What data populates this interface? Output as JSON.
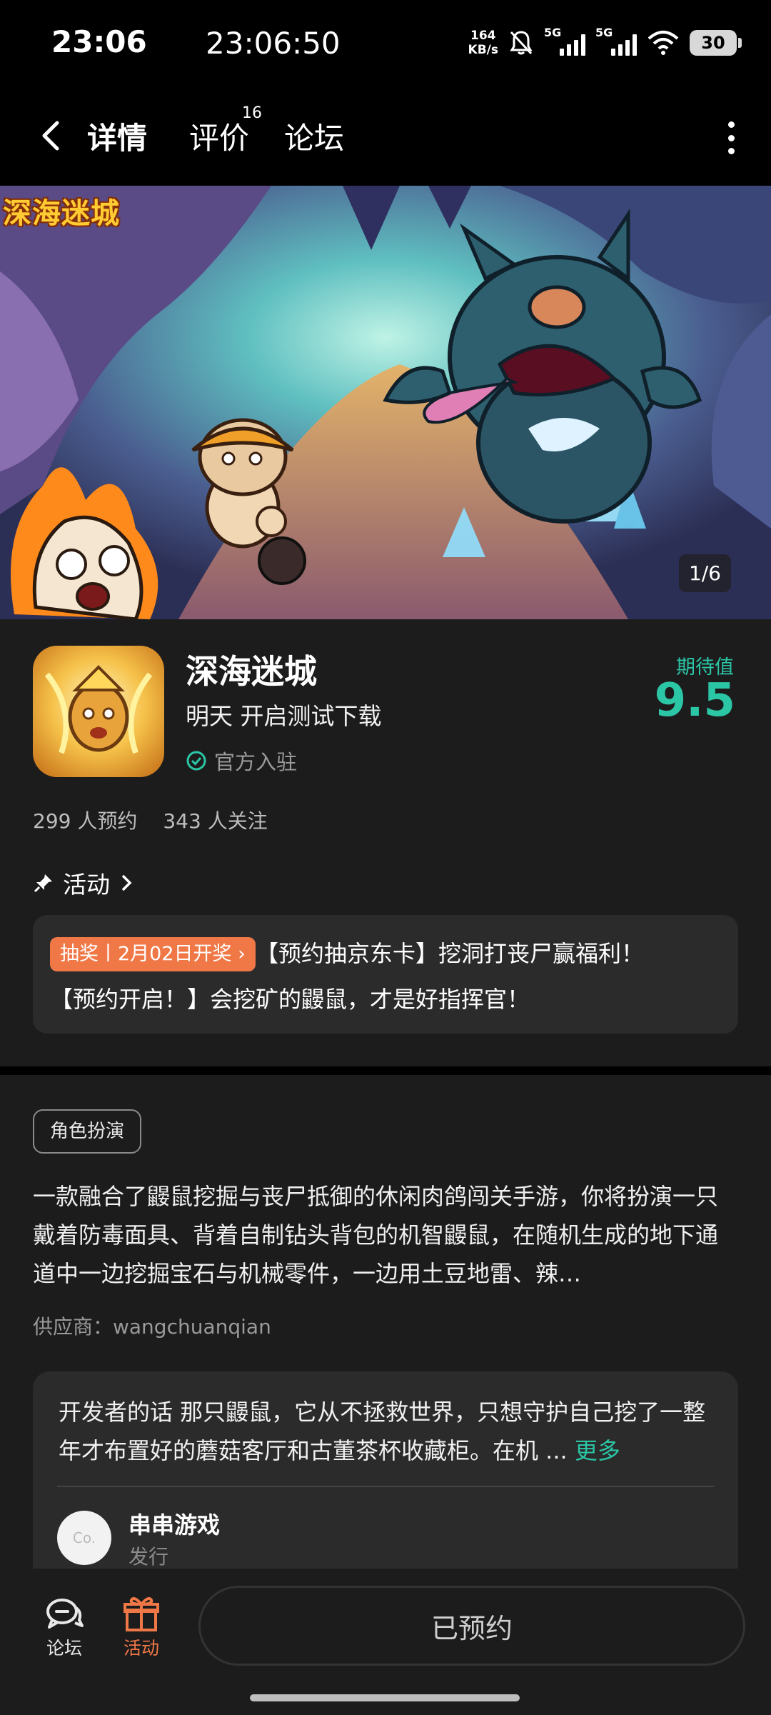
{
  "status_bar": {
    "time": "23:06",
    "clock": "23:06:50",
    "speed_value": "164",
    "speed_unit": "KB/s",
    "net1": "5G",
    "net2": "5G",
    "battery": "30"
  },
  "nav": {
    "tabs": [
      "详情",
      "评价",
      "论坛"
    ],
    "review_count": "16"
  },
  "banner": {
    "game_logo_text": "深海迷城",
    "counter": "1/6"
  },
  "app": {
    "name": "深海迷城",
    "status": "明天 开启测试下载",
    "official": "官方入驻",
    "score_label": "期待值",
    "score": "9.5"
  },
  "stats": {
    "reservations": "299 人预约",
    "followers": "343 人关注"
  },
  "activity": {
    "label": "活动",
    "tag": "抽奖丨2月02日开奖",
    "line1": "【预约抽京东卡】挖洞打丧尸赢福利！",
    "line2": "【预约开启！】会挖矿的鼹鼠，才是好指挥官！"
  },
  "details": {
    "genre": "角色扮演",
    "description": "一款融合了鼹鼠挖掘与丧尸抵御的休闲肉鸽闯关手游，你将扮演一只戴着防毒面具、背着自制钻头背包的机智鼹鼠，在随机生成的地下通道中一边挖掘宝石与机械零件，一边用土豆地雷、辣…",
    "supplier": "供应商：wangchuanqian"
  },
  "developer": {
    "words": "开发者的话  那只鼹鼠，它从不拯救世界，只想守护自己挖了一整年才布置好的蘑菇客厅和古董茶杯收藏柜。在机 ... ",
    "more": "更多",
    "avatar_text": "Co.",
    "publisher": "串串游戏",
    "role": "发行"
  },
  "bottom": {
    "forum": "论坛",
    "activity": "活动",
    "reserved": "已预约"
  },
  "colors": {
    "accent": "#2bc6a6",
    "orange": "#f07846",
    "background": "#1c1c1c",
    "card": "#2b2b2b"
  }
}
